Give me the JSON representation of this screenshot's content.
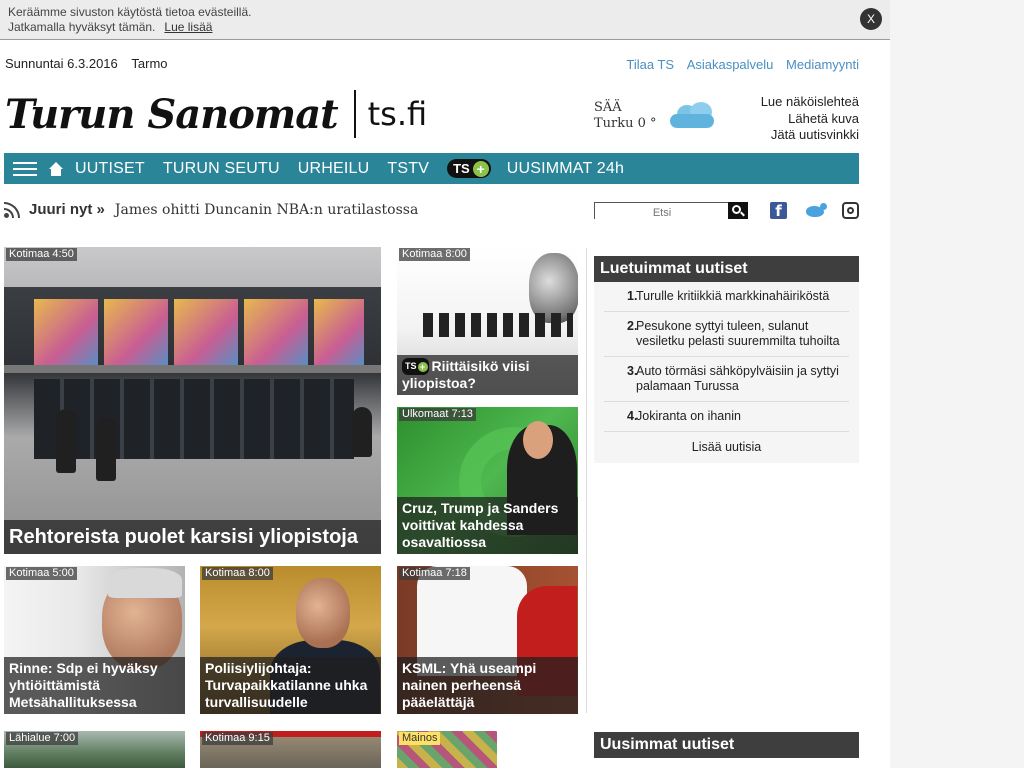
{
  "cookie": {
    "line1": "Keräämme sivuston käytöstä tietoa evästeillä.",
    "line2": "Jatkamalla hyväksyt tämän.",
    "link": "Lue lisää",
    "close": "X"
  },
  "header": {
    "date": "Sunnuntai 6.3.2016",
    "nameday": "Tarmo",
    "top_links": [
      "Tilaa TS",
      "Asiakaspalvelu",
      "Mediamyynti"
    ],
    "logo_mast": "Turun Sanomat",
    "logo_site": "ts.fi",
    "weather_label": "SÄÄ",
    "weather_value": "Turku 0 °",
    "side_links": [
      "Lue näköislehteä",
      "Lähetä kuva",
      "Jätä uutisvinkki"
    ]
  },
  "nav": {
    "items": [
      "UUTISET",
      "TURUN SEUTU",
      "URHEILU",
      "TSTV"
    ],
    "tsplus": "TS",
    "latest": "UUSIMMAT 24h"
  },
  "ticker": {
    "label": "Juuri nyt »",
    "headline": "James ohitti Duncanin NBA:n uratilastossa",
    "search_placeholder": "Etsi"
  },
  "articles": [
    {
      "tag": "Kotimaa 4:50",
      "title": "Rehtoreista puolet karsisi yliopistoja"
    },
    {
      "tag": "Kotimaa 8:00",
      "title": "Riittäisikö viisi yliopistoa?",
      "badge": "TS"
    },
    {
      "tag": "Ulkomaat 7:13",
      "title": "Cruz, Trump ja Sanders voittivat kahdessa osavaltiossa"
    },
    {
      "tag": "Kotimaa 5:00",
      "title": "Rinne: Sdp ei hyväksy yhtiöittämistä Metsähallituksessa"
    },
    {
      "tag": "Kotimaa 8:00",
      "title": "Poliisiylijohtaja: Turvapaikkatilanne uhka turvallisuudelle"
    },
    {
      "tag": "Kotimaa 7:18",
      "title": "KSML: Yhä useampi nainen perheensä pääelättäjä"
    },
    {
      "tag": "Lähialue 7:00"
    },
    {
      "tag": "Kotimaa 9:15"
    },
    {
      "tag": "Mainos"
    }
  ],
  "sidebar": {
    "popular_title": "Luetuimmat uutiset",
    "popular": [
      {
        "n": "1.",
        "title": "Turulle kritiikkiä markkinahäiriköstä"
      },
      {
        "n": "2.",
        "title": "Pesukone syttyi tuleen, sulanut vesiletku pelasti suuremmilta tuhoilta"
      },
      {
        "n": "3.",
        "title": "Auto törmäsi sähköpylväisiin ja syttyi palamaan Turussa"
      },
      {
        "n": "4.",
        "title": "Jokiranta on ihanin"
      }
    ],
    "more": "Lisää uutisia",
    "latest_title": "Uusimmat uutiset"
  },
  "colors": {
    "nav_bg": "#2b8599",
    "link_blue": "#4a8fc2",
    "box_head": "#3e3e3e",
    "plus_green": "#8bc34a"
  }
}
